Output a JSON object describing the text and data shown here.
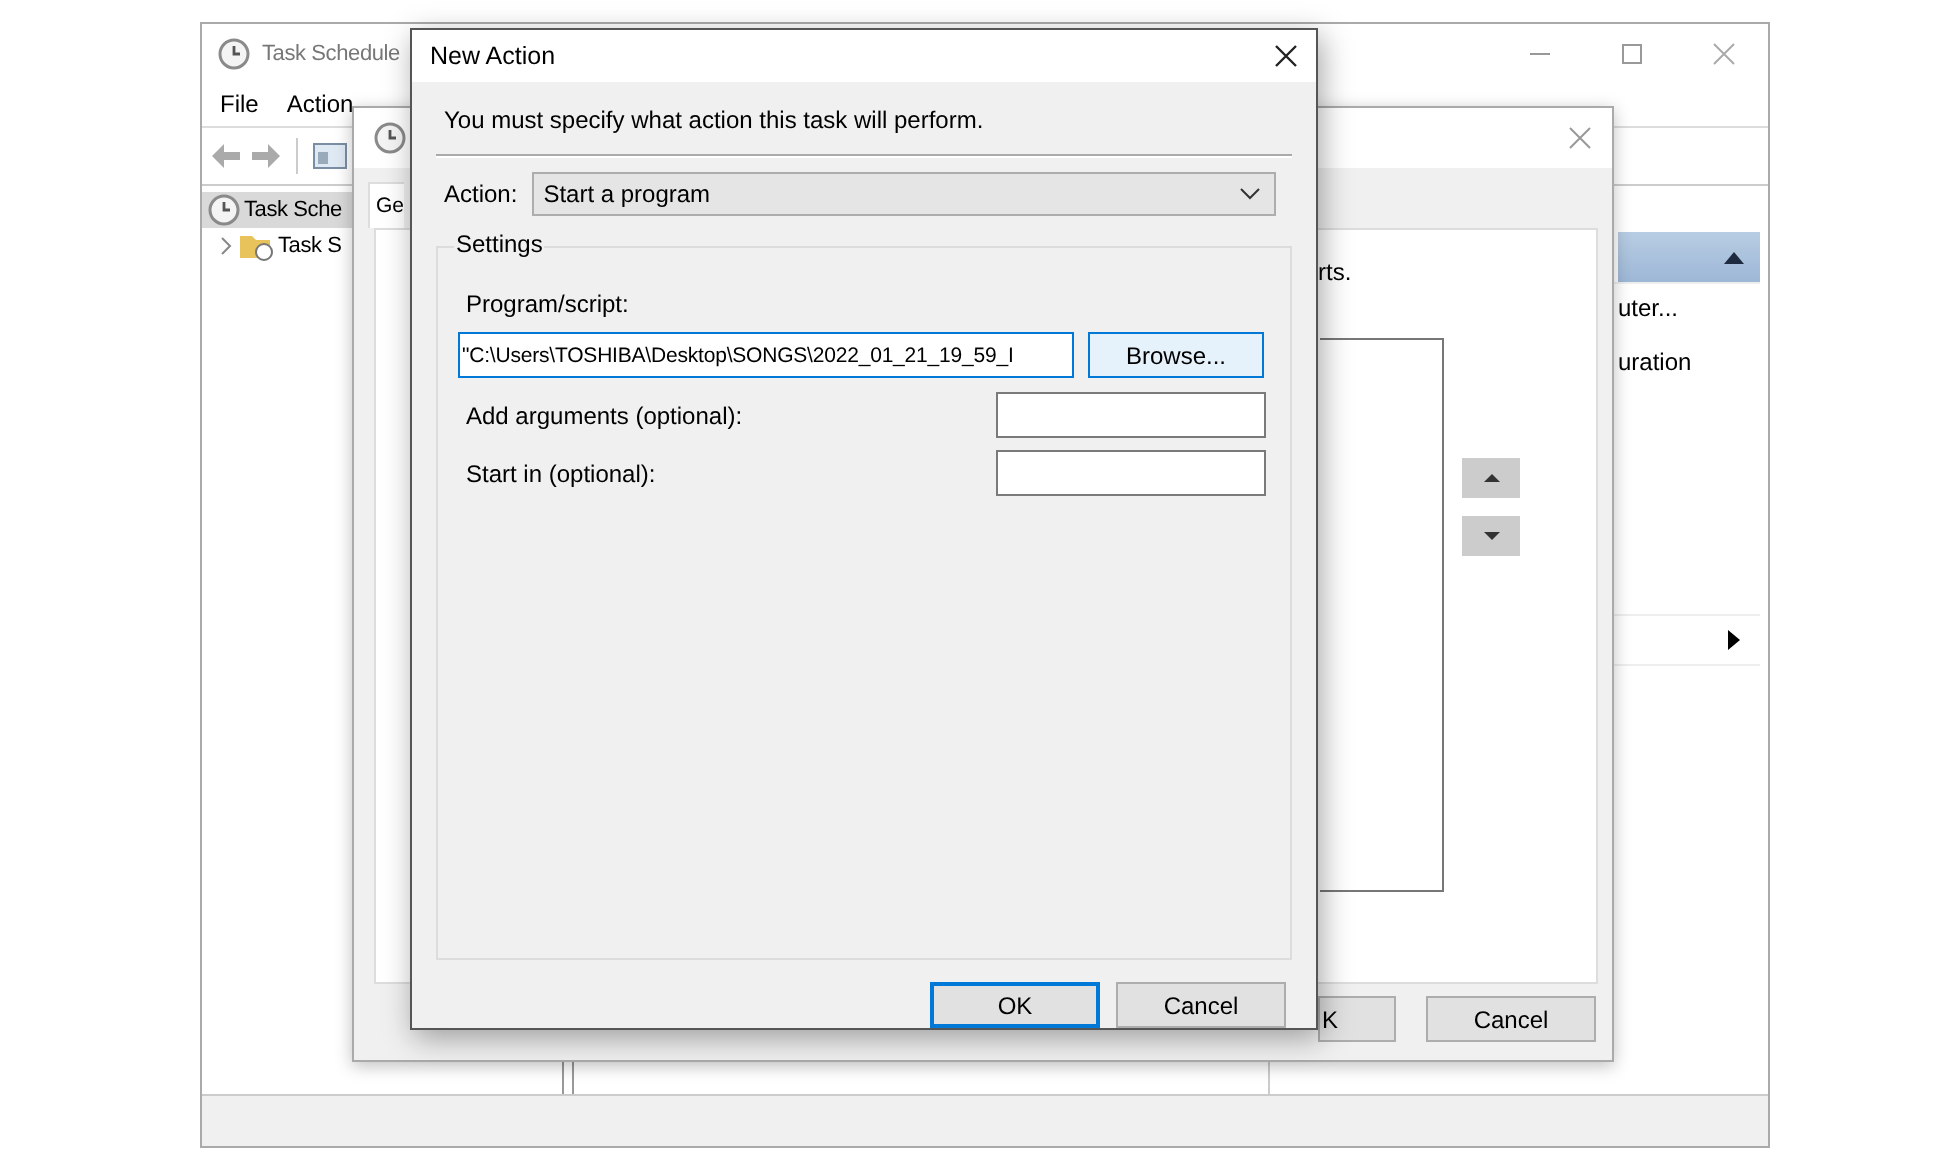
{
  "main_window": {
    "title": "Task Schedule",
    "menu": [
      "File",
      "Action"
    ],
    "tree": [
      {
        "label": "Task Sche",
        "children": [
          {
            "label": "Task S",
            "expanded": false
          }
        ]
      }
    ],
    "actions_pane": {
      "items": [
        {
          "label": "uter...",
          "kind": "text"
        },
        {
          "label": "uration",
          "kind": "text"
        },
        {
          "kind": "submenu"
        }
      ]
    }
  },
  "create_task_window": {
    "tabs": [
      {
        "label": "Ge",
        "selected": true
      }
    ],
    "description": "rts.",
    "buttons": [
      "K",
      "Cancel"
    ]
  },
  "new_action_dialog": {
    "title": "New Action",
    "instruction": "You must specify what action this task will perform.",
    "action_label": "Action:",
    "action_value": "Start a program",
    "settings": {
      "legend": "Settings",
      "program_label": "Program/script:",
      "program_value": "\"C:\\Users\\TOSHIBA\\Desktop\\SONGS\\2022_01_21_19_59_I",
      "browse": "Browse...",
      "arguments_label": "Add arguments (optional):",
      "start_in_label": "Start in (optional):"
    },
    "buttons": [
      {
        "label": "OK",
        "default": true
      },
      {
        "label": "Cancel",
        "default": false
      }
    ]
  }
}
